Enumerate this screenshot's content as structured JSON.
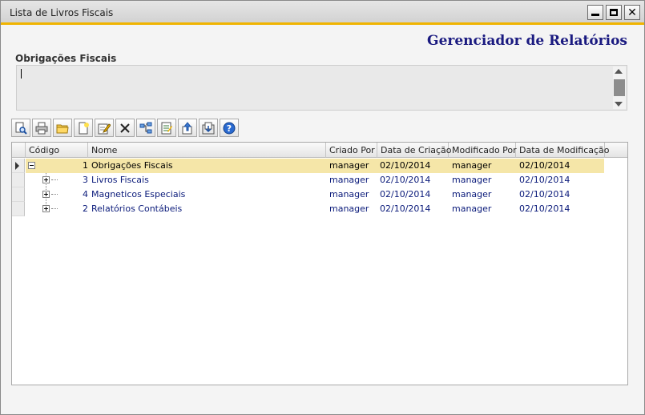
{
  "window": {
    "title": "Lista de Livros Fiscais",
    "controls": {
      "minimize_icon": "minimize-icon",
      "maximize_icon": "maximize-icon",
      "close_label": "✕"
    }
  },
  "header": {
    "title": "Gerenciador de Relatórios"
  },
  "description": {
    "label": "Obrigações Fiscais",
    "value": ""
  },
  "toolbar": {
    "buttons": [
      {
        "icon": "preview-icon"
      },
      {
        "icon": "print-icon"
      },
      {
        "icon": "open-folder-icon"
      },
      {
        "icon": "new-document-icon"
      },
      {
        "icon": "edit-icon"
      },
      {
        "icon": "delete-icon"
      },
      {
        "icon": "hierarchy-icon"
      },
      {
        "icon": "properties-icon"
      },
      {
        "icon": "export-icon"
      },
      {
        "icon": "import-icon"
      },
      {
        "icon": "help-icon"
      }
    ]
  },
  "grid": {
    "columns": [
      "Código",
      "Nome",
      "Criado Por",
      "Data de Criação",
      "Modificado Por",
      "Data de Modificação"
    ],
    "rows": [
      {
        "code": "1",
        "name": "Obrigações Fiscais",
        "created_by": "manager",
        "created_on": "02/10/2014",
        "modified_by": "manager",
        "modified_on": "02/10/2014",
        "level": 0,
        "expanded": true,
        "selected": true
      },
      {
        "code": "3",
        "name": "Livros Fiscais",
        "created_by": "manager",
        "created_on": "02/10/2014",
        "modified_by": "manager",
        "modified_on": "02/10/2014",
        "level": 1,
        "expanded": false,
        "selected": false
      },
      {
        "code": "4",
        "name": "Magneticos Especiais",
        "created_by": "manager",
        "created_on": "02/10/2014",
        "modified_by": "manager",
        "modified_on": "02/10/2014",
        "level": 1,
        "expanded": false,
        "selected": false
      },
      {
        "code": "2",
        "name": "Relatórios Contábeis",
        "created_by": "manager",
        "created_on": "02/10/2014",
        "modified_by": "manager",
        "modified_on": "02/10/2014",
        "level": 1,
        "expanded": false,
        "selected": false
      }
    ]
  },
  "colors": {
    "accent": "#f0b400",
    "title_text": "#1a1a80",
    "selected_row": "#f5e6a8",
    "row_text": "#0a1a7a"
  }
}
